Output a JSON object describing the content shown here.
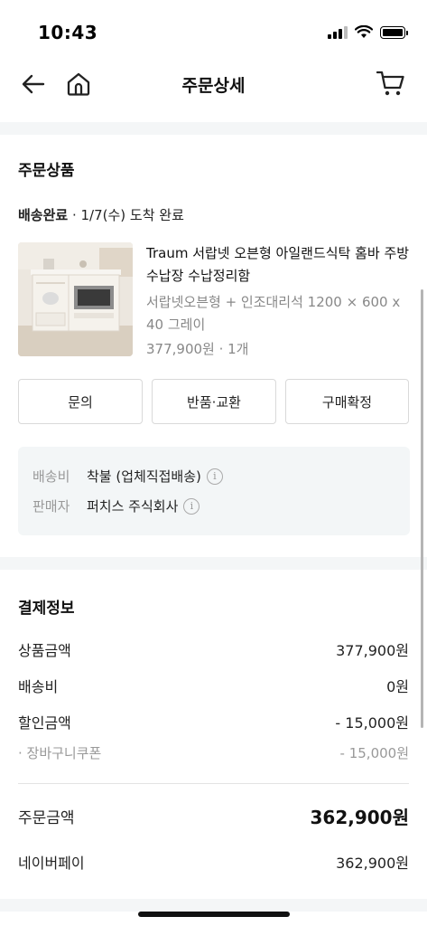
{
  "status_bar": {
    "time": "10:43"
  },
  "nav": {
    "title": "주문상세"
  },
  "order_section": {
    "title": "주문상품",
    "delivery_status": "배송완료",
    "delivery_detail": " · 1/7(수) 도착 완료",
    "product": {
      "name": "Traum 서랍넷 오븐형 아일랜드식탁 홈바 주방수납장 수납정리함",
      "option": "서랍넷오븐형 + 인조대리석 1200 × 600 x 40 그레이",
      "price_qty": "377,900원 · 1개"
    },
    "buttons": {
      "inquiry": "문의",
      "return_exchange": "반품·교환",
      "confirm_purchase": "구매확정"
    },
    "info": {
      "shipping_label": "배송비",
      "shipping_value": "착불 (업체직접배송)",
      "seller_label": "판매자",
      "seller_value": "퍼치스 주식회사"
    }
  },
  "payment_section": {
    "title": "결제정보",
    "rows": [
      {
        "label": "상품금액",
        "value": "377,900원"
      },
      {
        "label": "배송비",
        "value": "0원"
      },
      {
        "label": "할인금액",
        "value": "- 15,000원"
      }
    ],
    "coupon": {
      "label": "· 장바구니쿠폰",
      "value": "- 15,000원"
    },
    "total": {
      "label": "주문금액",
      "value": "362,900원"
    },
    "method": {
      "label": "네이버페이",
      "value": "362,900원"
    }
  }
}
